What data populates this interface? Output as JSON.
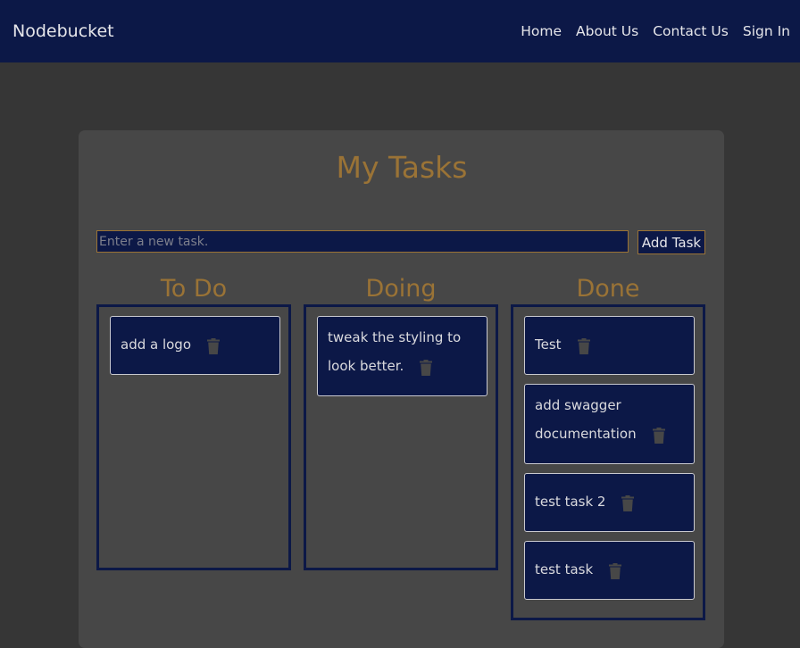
{
  "navbar": {
    "brand": "Nodebucket",
    "links": [
      "Home",
      "About Us",
      "Contact Us",
      "Sign In"
    ]
  },
  "page": {
    "title": "My Tasks"
  },
  "new_task": {
    "placeholder": "Enter a new task.",
    "value": "",
    "button_label": "Add Task"
  },
  "columns": {
    "todo": {
      "title": "To Do",
      "tasks": [
        "add a logo"
      ]
    },
    "doing": {
      "title": "Doing",
      "tasks": [
        "tweak the styling to look better."
      ]
    },
    "done": {
      "title": "Done",
      "tasks": [
        "Test",
        "add swagger documentation",
        "test task 2",
        "test task"
      ]
    }
  },
  "icons": {
    "delete": "trash-icon"
  },
  "colors": {
    "navy": "#0c1847",
    "gold": "#9a7336",
    "background": "#363636",
    "card": "#474747",
    "trash": "#474747"
  }
}
